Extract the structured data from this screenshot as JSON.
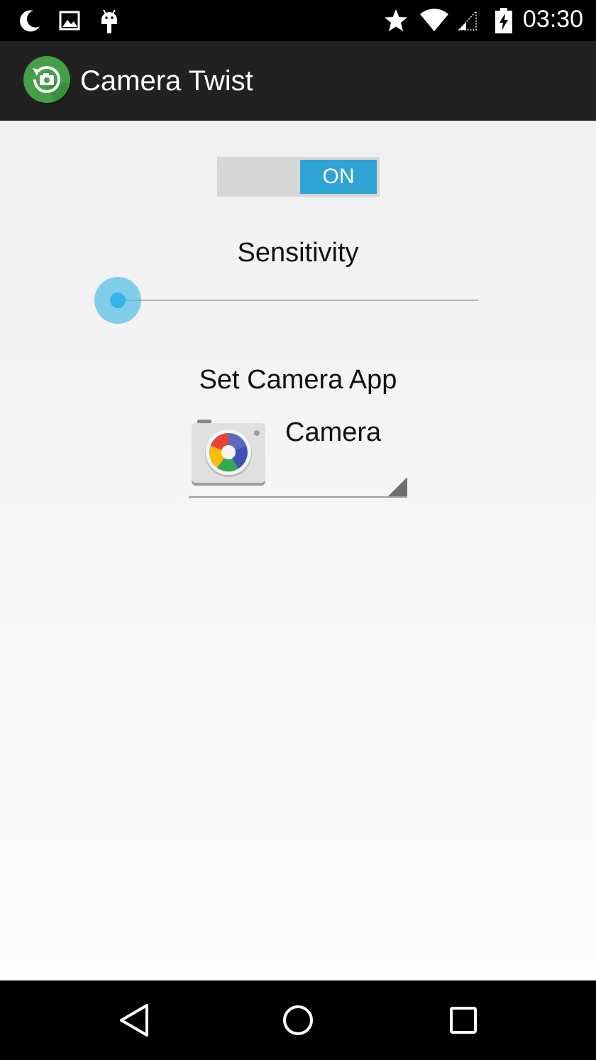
{
  "status_bar": {
    "time": "03:30",
    "left_icons": [
      "moon-icon",
      "image-icon",
      "android-debug-icon"
    ],
    "right_icons": [
      "star-icon",
      "wifi-icon",
      "signal-icon",
      "battery-charging-icon"
    ]
  },
  "action_bar": {
    "title": "Camera Twist",
    "logo_icon": "camera-rotate-icon",
    "logo_color": "#43a047"
  },
  "main": {
    "toggle": {
      "label": "ON",
      "state": true,
      "accent": "#2ea3d4"
    },
    "sensitivity": {
      "label": "Sensitivity",
      "value_fraction": 0.0,
      "accent": "#33b5e5"
    },
    "camera_app": {
      "label": "Set Camera App",
      "selected_app": "Camera",
      "selected_icon": "camera-app-icon"
    }
  },
  "nav_bar": {
    "buttons": [
      "back-icon",
      "home-icon",
      "recents-icon"
    ]
  }
}
